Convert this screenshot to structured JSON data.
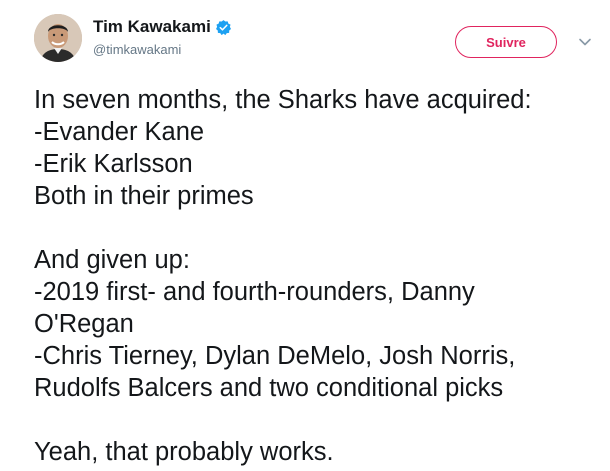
{
  "author": {
    "display_name": "Tim Kawakami",
    "handle": "@timkawakami",
    "verified": true,
    "avatar_icon": "avatar-photo"
  },
  "follow_button": {
    "label": "Suivre"
  },
  "menu": {
    "icon": "chevron-down-icon"
  },
  "tweet": {
    "lines": [
      "In seven months, the Sharks have acquired:",
      "-Evander Kane",
      "-Erik Karlsson",
      "Both in their primes",
      "",
      "And given up:",
      "-2019 first- and fourth-rounders, Danny",
      "O'Regan",
      "-Chris Tierney, Dylan DeMelo, Josh Norris,",
      "Rudolfs Balcers and two conditional picks",
      "",
      "Yeah, that probably works."
    ]
  },
  "colors": {
    "follow_accent": "#e0245e",
    "verified_blue": "#1da1f2",
    "text": "#14171a",
    "secondary_text": "#657786"
  }
}
